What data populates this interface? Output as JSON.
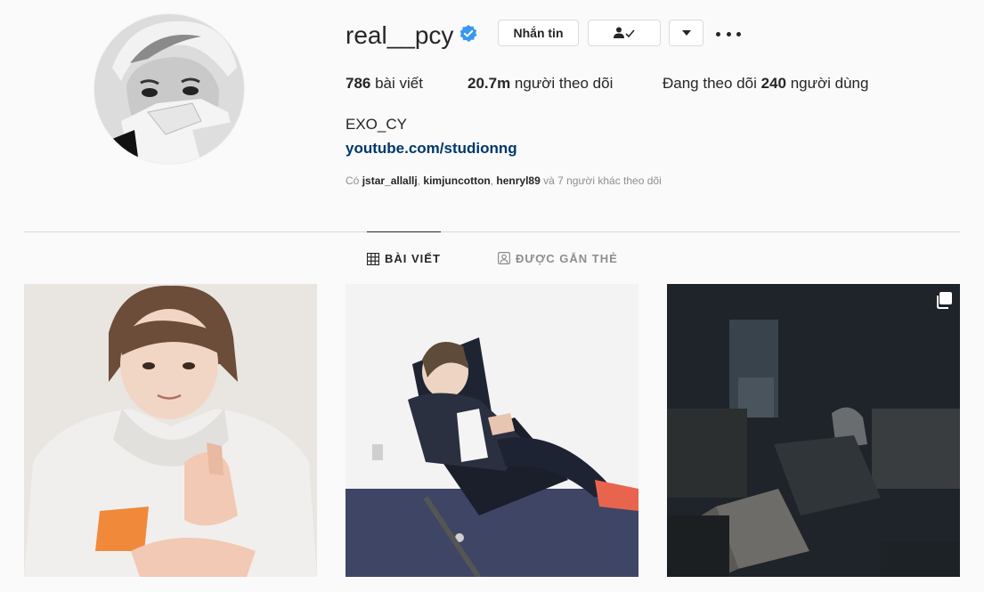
{
  "profile": {
    "username": "real__pcy",
    "full_name": "EXO_CY",
    "link": "youtube.com/studionng"
  },
  "actions": {
    "message_label": "Nhắn tin"
  },
  "stats": {
    "posts_count": "786",
    "posts_label": " bài viết",
    "followers_count": "20.7m",
    "followers_label": " người theo dõi",
    "following_prefix": "Đang theo dõi ",
    "following_count": "240",
    "following_label": " người dùng"
  },
  "followed_by": {
    "prefix": "Có ",
    "user1": "jstar_allallj",
    "sep1": ", ",
    "user2": "kimjuncotton",
    "sep2": ", ",
    "user3": "henryl89",
    "suffix": " và 7 người khác theo dõi"
  },
  "tabs": {
    "posts": "BÀI VIẾT",
    "tagged": "ĐƯỢC GẮN THẺ"
  },
  "icons": {
    "verified": "verified-badge-icon",
    "following": "person-check-icon",
    "dropdown": "caret-down-icon",
    "more": "more-options-icon",
    "grid": "grid-icon",
    "tagged": "tagged-person-icon",
    "multi": "multiple-photos-icon"
  },
  "colors": {
    "verified": "#3897f0",
    "link": "#00376b",
    "text": "#262626",
    "muted": "#8e8e8e",
    "border": "#dbdbdb",
    "background": "#fafafa"
  }
}
